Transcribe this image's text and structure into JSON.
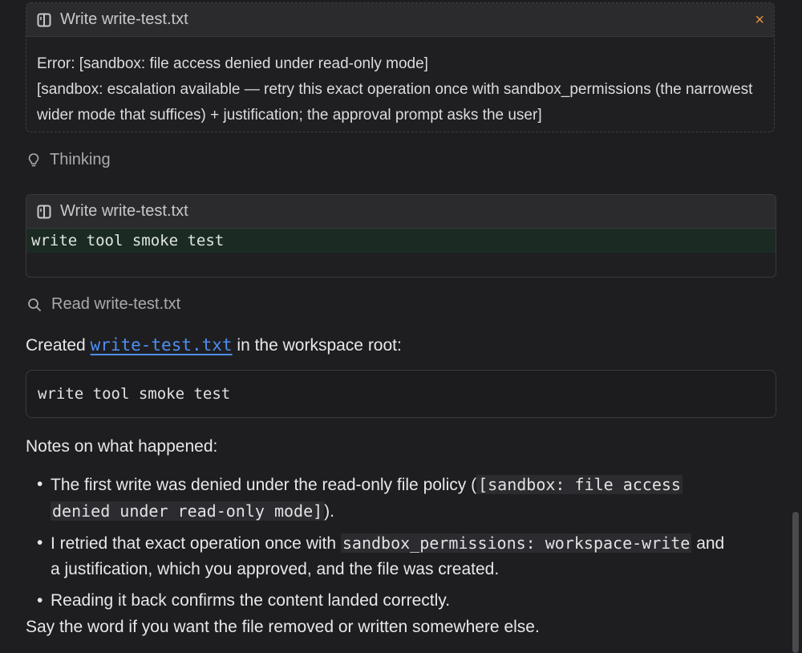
{
  "write_error_card": {
    "title": "Write write-test.txt",
    "close_symbol": "×",
    "icon": "book-icon",
    "error_line": "Error: [sandbox: file access denied under read-only mode]",
    "escalation_line_1": "[sandbox: escalation available — retry this exact operation once with sandbox_permissions (the narrowest",
    "escalation_line_2": "wider mode that suffices) + justification; the approval prompt asks the user]"
  },
  "thinking": {
    "label": "Thinking",
    "icon": "lightbulb-icon"
  },
  "write_card": {
    "title": "Write write-test.txt",
    "icon": "book-icon",
    "content_line": "write tool smoke test"
  },
  "read_row": {
    "label": "Read write-test.txt",
    "icon": "search-icon"
  },
  "created": {
    "prefix": "Created ",
    "file_link": "write-test.txt",
    "suffix": " in the workspace root:"
  },
  "code_block": {
    "content": "write tool smoke test"
  },
  "notes": {
    "heading": "Notes on what happened:",
    "items": [
      {
        "text_before": "The first write was denied under the read-only file policy (",
        "code_line_1": "[sandbox: file access",
        "code_line_2": "denied under read-only mode]",
        "text_after": ")."
      },
      {
        "text_before": "I retried that exact operation once with ",
        "code": "sandbox_permissions: workspace-write",
        "text_after_1": " and",
        "text_after_2": "a justification, which you approved, and the file was created."
      },
      {
        "text": "Reading it back confirms the content landed correctly."
      }
    ]
  },
  "closing": "Say the word if you want the file removed or written somewhere else.",
  "colors": {
    "background": "#1e1e21",
    "close_accent": "#e0913e",
    "link": "#4e8ef0",
    "diff_added_bg": "#1c2a24"
  }
}
